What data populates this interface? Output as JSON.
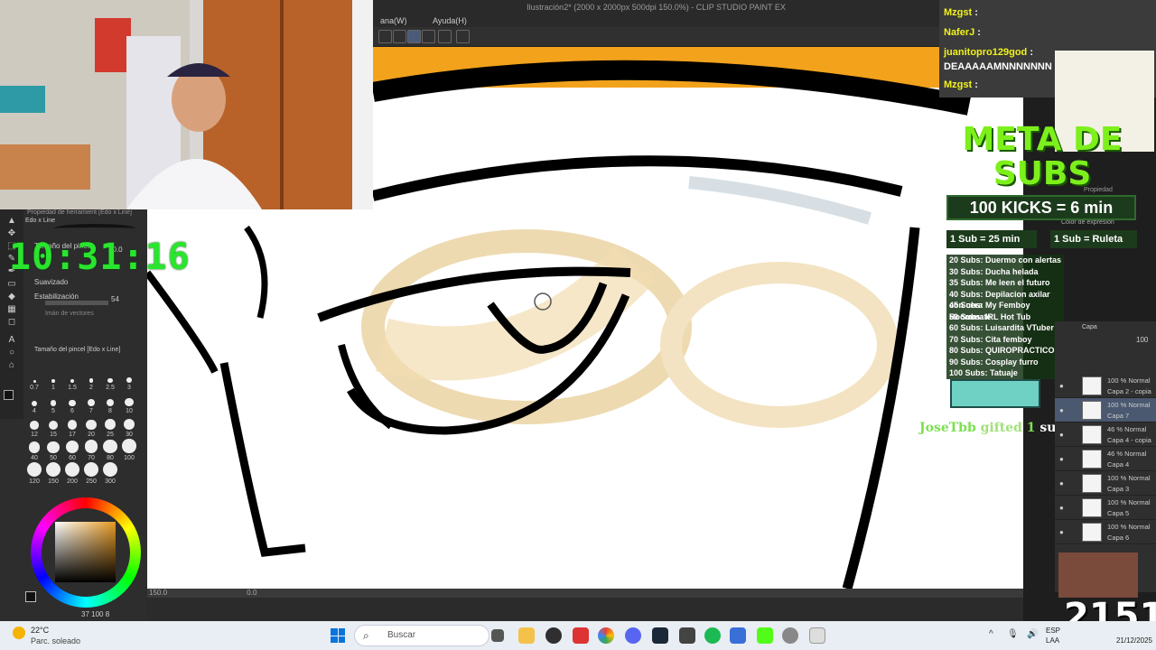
{
  "app": {
    "title": "Ilustración2* (2000 x 2000px 500dpi 150.0%) - CLIP STUDIO PAINT EX",
    "menu": [
      "ana(W)",
      "Ayuda(H)"
    ]
  },
  "canvas": {
    "zoom": "150.0",
    "rotation": "0.0"
  },
  "left_panel": {
    "brush_header": "Propiedad de herramient [Edo x Line]",
    "brush_name": "Edo x Line",
    "brush_size_label": "Tamaño del pincel",
    "brush_size_value": "20.0",
    "smoothing_label": "Suavizado",
    "stabilization_label": "Estabilización",
    "stabilization_value": "54",
    "vector_label": "Imán de vectores",
    "brush_size_panel_title": "Tamaño del pincel [Edo x Line]",
    "brush_sizes": [
      "0.7",
      "1",
      "1.5",
      "2",
      "2.5",
      "3",
      "4",
      "5",
      "6",
      "7",
      "8",
      "10",
      "12",
      "15",
      "17",
      "20",
      "25",
      "30",
      "40",
      "50",
      "60",
      "70",
      "80",
      "100",
      "120",
      "150",
      "200",
      "250",
      "300"
    ],
    "color_values": [
      "37",
      "100",
      "8"
    ]
  },
  "stream_timer": "10:31:16",
  "chat": [
    {
      "user": "Mzgst",
      "msg": ""
    },
    {
      "user": "NaferJ",
      "msg": ""
    },
    {
      "user": "juanitopro129god",
      "msg": "DEAAAAAMNNNNNNN"
    },
    {
      "user": "Mzgst",
      "msg": ""
    }
  ],
  "overlay": {
    "meta_title": "META DE SUBS",
    "kicks": "100 KICKS = 6 min",
    "sub_time": "1 Sub = 25 min",
    "sub_roulette": "1 Sub = Ruleta",
    "goals": [
      "20 Subs: Duermo con alertas",
      "30 Subs: Ducha helada",
      "35 Subs: Me leen el futuro",
      "40 Subs: Depilacion axilar con cera",
      "45 Subs: My Femboy Roommate",
      "50 Subs: IRL Hot Tub",
      "60 Subs: Luisardita VTuber",
      "70 Subs: Cita femboy",
      "80 Subs: QUIROPRACTICO",
      "90 Subs: Cosplay furro",
      "100 Subs: Tatuaje"
    ],
    "gift_user": "JoseTbb",
    "gift_text": "gifted",
    "gift_count": "1",
    "gift_suffix": "sub(s)!",
    "sub_count": "2151"
  },
  "right_panels": {
    "property_label": "Propiedad",
    "expression_label": "Color de expresión",
    "layers_title": "Capa",
    "layer_opacity": "100",
    "layers": [
      {
        "mode": "100 % Normal",
        "name": "Capa 2 - copia"
      },
      {
        "mode": "100 % Normal",
        "name": "Capa 7"
      },
      {
        "mode": "46 % Normal",
        "name": "Capa 4 - copia"
      },
      {
        "mode": "46 % Normal",
        "name": "Capa 4"
      },
      {
        "mode": "100 % Normal",
        "name": "Capa 3"
      },
      {
        "mode": "100 % Normal",
        "name": "Capa 5"
      },
      {
        "mode": "100 % Normal",
        "name": "Capa 6"
      }
    ]
  },
  "taskbar": {
    "temperature": "22°C",
    "weather": "Parc. soleado",
    "search_placeholder": "Buscar",
    "lang_1": "ESP",
    "lang_2": "LAA",
    "date": "21/12/2025"
  },
  "colors": {
    "accent_green": "#29e52e",
    "meta_green": "#7df01c",
    "chat_bg": "#3b3b3b"
  }
}
